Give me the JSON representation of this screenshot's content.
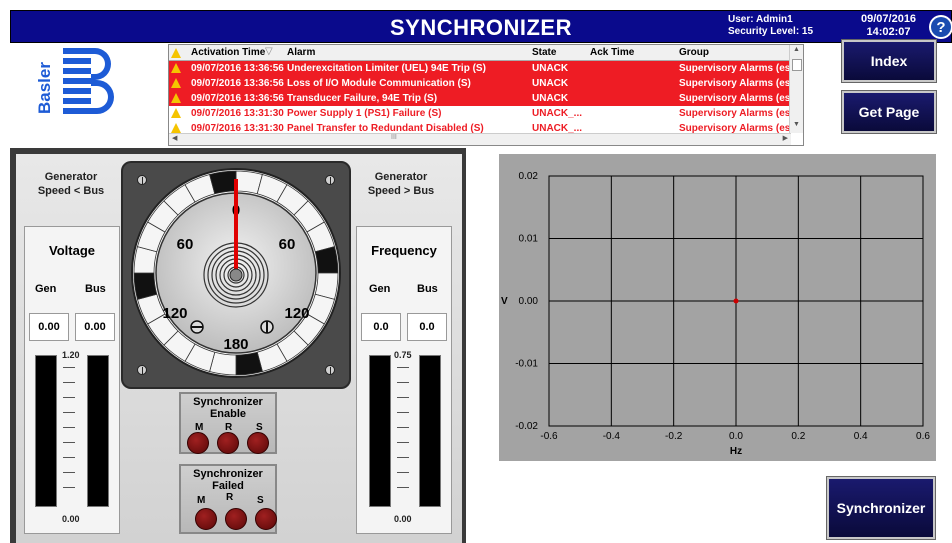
{
  "header": {
    "title": "SYNCHRONIZER",
    "user": "User: Admin1",
    "security": "Security Level: 15",
    "date": "09/07/2016",
    "time": "14:02:07",
    "help_glyph": "?"
  },
  "logo": {
    "text": "Basler"
  },
  "alarm_table": {
    "columns": [
      "Activation Time",
      "Alarm",
      "State",
      "Ack Time",
      "Group"
    ],
    "rows": [
      {
        "time": "09/07/2016 13:36:56",
        "alarm": "Underexcitation Limiter (UEL) 94E Trip (S)",
        "state": "UNACK",
        "ack": "",
        "group": "Supervisory Alarms (es)",
        "style": "red"
      },
      {
        "time": "09/07/2016 13:36:56",
        "alarm": "Loss of I/O Module Communication (S)",
        "state": "UNACK",
        "ack": "",
        "group": "Supervisory Alarms (es)",
        "style": "red"
      },
      {
        "time": "09/07/2016 13:36:56",
        "alarm": "Transducer Failure, 94E Trip (S)",
        "state": "UNACK",
        "ack": "",
        "group": "Supervisory Alarms (es)",
        "style": "red"
      },
      {
        "time": "09/07/2016 13:31:30",
        "alarm": "Power Supply 1 (PS1) Failure (S)",
        "state": "UNACK_...",
        "ack": "",
        "group": "Supervisory Alarms (es)",
        "style": "white"
      },
      {
        "time": "09/07/2016 13:31:30",
        "alarm": "Panel Transfer to Redundant Disabled (S)",
        "state": "UNACK_...",
        "ack": "",
        "group": "Supervisory Alarms (es)",
        "style": "white"
      }
    ],
    "hscroll_mark": "III"
  },
  "nav": {
    "index": "Index",
    "get_page": "Get Page",
    "synchronizer": "Synchronizer"
  },
  "synchroscope": {
    "slow_label": "Generator\nSpeed < Bus",
    "fast_label": "Generator\nSpeed > Bus",
    "dial_labels": {
      "top": "0",
      "left60": "60",
      "right60": "60",
      "left120": "120",
      "right120": "120",
      "bottom": "180"
    },
    "pointer_angle_deg": 0
  },
  "voltage": {
    "title": "Voltage",
    "gen_label": "Gen",
    "bus_label": "Bus",
    "gen_value": "0.00",
    "bus_value": "0.00",
    "scale_max": "1.20",
    "scale_min": "0.00",
    "gen_level": 0,
    "bus_level": 0
  },
  "frequency": {
    "title": "Frequency",
    "gen_label": "Gen",
    "bus_label": "Bus",
    "gen_value": "0.0",
    "bus_value": "0.0",
    "scale_max": "0.75",
    "scale_min": "0.00",
    "gen_level": 0,
    "bus_level": 0
  },
  "enable_box": {
    "title": "Synchronizer\nEnable",
    "labels": [
      "M",
      "R",
      "S"
    ]
  },
  "failed_box": {
    "title": "Synchronizer\nFailed",
    "labels": [
      "M",
      "R",
      "S"
    ]
  },
  "chart_data": {
    "type": "scatter",
    "title": "",
    "xlabel": "Hz",
    "ylabel": "V",
    "xlim": [
      -0.6,
      0.6
    ],
    "ylim": [
      -0.02,
      0.02
    ],
    "x_ticks": [
      "-0.6",
      "-0.4",
      "-0.2",
      "0.0",
      "0.2",
      "0.4",
      "0.6"
    ],
    "y_ticks": [
      "0.02",
      "0.01",
      "0.00",
      "-0.01",
      "-0.02"
    ],
    "points": [
      {
        "x": 0.0,
        "y": 0.0
      }
    ],
    "grid": true,
    "point_color": "#cc0000"
  },
  "colors": {
    "header_bg": "#0a0a8c",
    "alarm_red": "#ee1c24",
    "plot_bg": "#a3a3a3"
  }
}
